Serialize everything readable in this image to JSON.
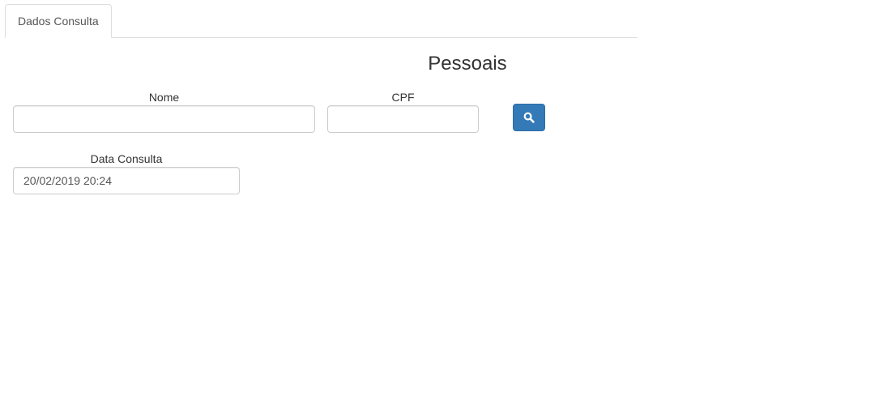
{
  "tabs": [
    {
      "label": "Dados Consulta"
    }
  ],
  "section": {
    "title": "Pessoais"
  },
  "form": {
    "nome": {
      "label": "Nome",
      "value": ""
    },
    "cpf": {
      "label": "CPF",
      "value": ""
    },
    "data_consulta": {
      "label": "Data Consulta",
      "value": "20/02/2019 20:24"
    }
  },
  "search_button": {
    "icon": "search-icon",
    "color": "#337ab7"
  }
}
